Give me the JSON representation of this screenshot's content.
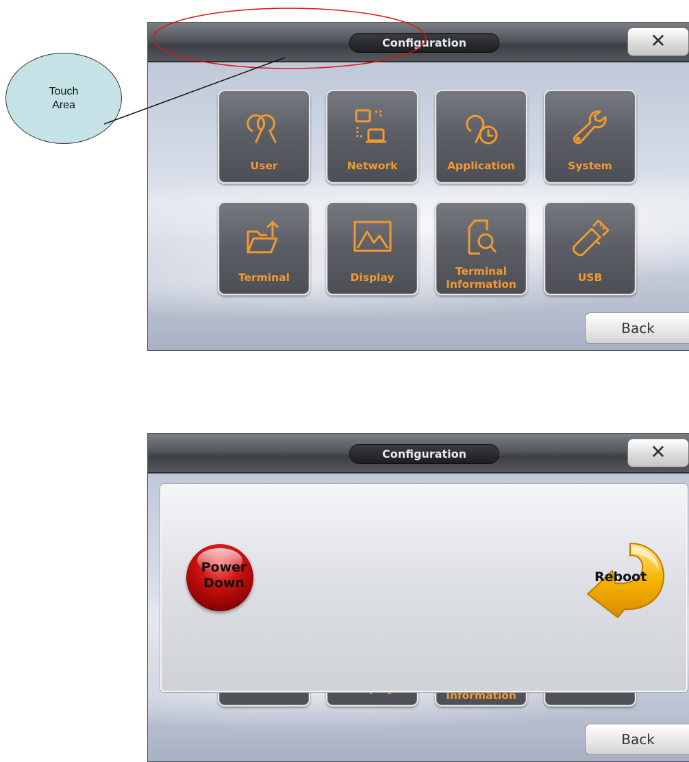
{
  "callout": {
    "line1": "Touch",
    "line2": "Area"
  },
  "screen": {
    "title": "Configuration",
    "close_label": "✕",
    "back_label": "Back",
    "tiles": [
      {
        "label": "User",
        "icon": "user-icon"
      },
      {
        "label": "Network",
        "icon": "network-icon"
      },
      {
        "label": "Application",
        "icon": "application-icon"
      },
      {
        "label": "System",
        "icon": "wrench-icon"
      },
      {
        "label": "Terminal",
        "icon": "folder-upload-icon"
      },
      {
        "label": "Display",
        "icon": "picture-icon"
      },
      {
        "label_line1": "Terminal",
        "label_line2": "Information",
        "icon": "document-search-icon"
      },
      {
        "label": "USB",
        "icon": "usb-icon"
      }
    ]
  },
  "dialog": {
    "power_line1": "Power",
    "power_line2": "Down",
    "reboot_label": "Reboot"
  },
  "colors": {
    "accent": "#f39a2e",
    "power": "#c00000",
    "reboot": "#f5a800",
    "callout": "#c5e3e6"
  }
}
